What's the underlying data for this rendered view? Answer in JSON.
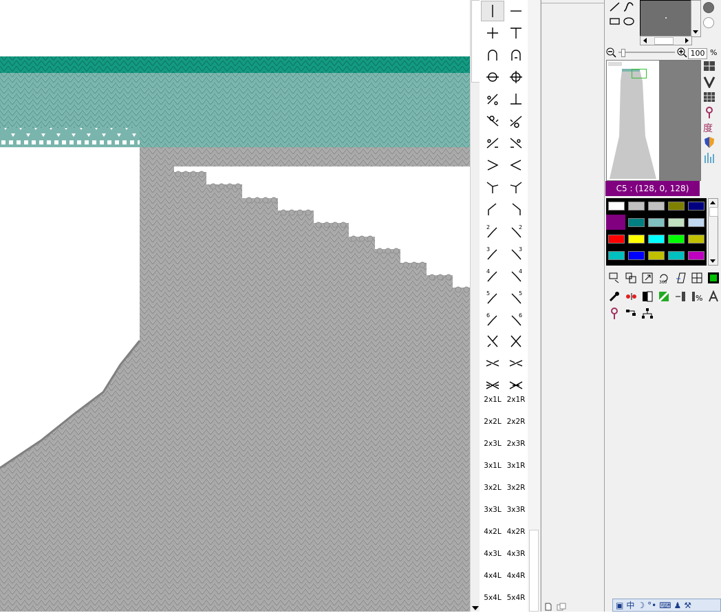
{
  "canvas": {
    "colors": {
      "teal": "#7ab5ad",
      "teal_dark": "#149a82",
      "gray": "#a9a9a9",
      "gray_line": "#8e8e8e",
      "bg": "#ffffff"
    }
  },
  "stitch_palette": {
    "text_buttons": [
      [
        "2x1L",
        "2x1R"
      ],
      [
        "2x2L",
        "2x2R"
      ],
      [
        "2x3L",
        "2x3R"
      ],
      [
        "3x1L",
        "3x1R"
      ],
      [
        "3x2L",
        "3x2R"
      ],
      [
        "3x3L",
        "3x3R"
      ],
      [
        "4x2L",
        "4x2R"
      ],
      [
        "4x3L",
        "4x3R"
      ],
      [
        "4x4L",
        "4x4R"
      ],
      [
        "5x4L",
        "5x4R"
      ]
    ],
    "icon_buttons": [
      [
        "stitch-vertical-icon",
        "stitch-horizontal-icon"
      ],
      [
        "stitch-cross-icon",
        "stitch-tee-icon"
      ],
      [
        "stitch-arch-icon",
        "stitch-arch-dot-icon"
      ],
      [
        "stitch-circle-line-icon",
        "stitch-circle-vline-icon"
      ],
      [
        "stitch-slash-dots-icon",
        "stitch-up-tee-icon"
      ],
      [
        "stitch-slash-left-icon",
        "stitch-slash-right-icon"
      ],
      [
        "stitch-slash-hook-left-icon",
        "stitch-slash-hook-right-icon"
      ],
      [
        "stitch-greater-than-icon",
        "stitch-less-than-icon"
      ],
      [
        "stitch-fork-left-icon",
        "stitch-fork-right-icon"
      ],
      [
        "stitch-corner-left-icon",
        "stitch-corner-right-icon"
      ],
      [
        "stitch-transfer-2-left-icon",
        "stitch-transfer-2-right-icon"
      ],
      [
        "stitch-transfer-3-left-icon",
        "stitch-transfer-3-right-icon"
      ],
      [
        "stitch-transfer-4-left-icon",
        "stitch-transfer-4-right-icon"
      ],
      [
        "stitch-transfer-5-left-icon",
        "stitch-transfer-5-right-icon"
      ],
      [
        "stitch-transfer-6-left-icon",
        "stitch-transfer-6-right-icon"
      ],
      [
        "stitch-cross-over-icon",
        "stitch-cross-under-icon"
      ],
      [
        "stitch-cable-2-icon",
        "stitch-cable-2b-icon"
      ],
      [
        "stitch-cable-3-icon",
        "stitch-cable-3b-icon"
      ]
    ],
    "transfer_numbers": [
      "2",
      "3",
      "4",
      "5",
      "6"
    ]
  },
  "zoom": {
    "value": "100",
    "unit": "%"
  },
  "color_panel": {
    "current_color_label": "C5 : (128, 0, 128)",
    "swatches": [
      [
        "#ffffff",
        "#c0c0c0",
        "#c0c0c0",
        "#808000",
        "#000080"
      ],
      [
        "#800080",
        "#008080",
        "#80c0c0",
        "#c0e0c0",
        "#c0d8f0"
      ],
      [
        "#ff0000",
        "#ffff00",
        "#00ffff",
        "#00ff00",
        "#c0c000"
      ],
      [
        "#00c0c0",
        "#0000ff",
        "#c0c000",
        "#00c0c0",
        "#c000c0"
      ]
    ]
  },
  "side_tools": {
    "degree_label": "度"
  },
  "taskbar": {
    "ime_label": "中"
  }
}
